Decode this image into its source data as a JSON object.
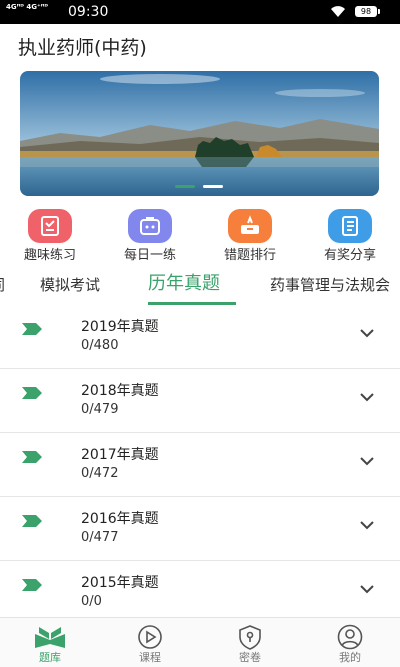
{
  "status_bar": {
    "network": "4Gᴴᴰ 4G⁺ᴴᴰ",
    "time": "09:30",
    "battery": "98"
  },
  "app_title": "执业药师(中药)",
  "banner": {
    "active_index": 0,
    "count": 2
  },
  "quick_actions": [
    {
      "label": "趣味练习",
      "icon": "form-icon",
      "color": "#f0626a"
    },
    {
      "label": "每日一练",
      "icon": "briefcase-icon",
      "color": "#8287ee"
    },
    {
      "label": "错题排行",
      "icon": "ranking-icon",
      "color": "#f57f3b"
    },
    {
      "label": "有奖分享",
      "icon": "notebook-icon",
      "color": "#3f9de8"
    }
  ],
  "tabs": [
    {
      "label": "同"
    },
    {
      "label": "模拟考试"
    },
    {
      "label": "历年真题",
      "active": true
    },
    {
      "label": "药事管理与法规会"
    }
  ],
  "exam_list": [
    {
      "title": "2019年真题",
      "progress": "0/480"
    },
    {
      "title": "2018年真题",
      "progress": "0/479"
    },
    {
      "title": "2017年真题",
      "progress": "0/472"
    },
    {
      "title": "2016年真题",
      "progress": "0/477"
    },
    {
      "title": "2015年真题",
      "progress": "0/0"
    }
  ],
  "bottom_nav": [
    {
      "label": "题库",
      "icon": "book-icon",
      "active": true
    },
    {
      "label": "课程",
      "icon": "play-icon"
    },
    {
      "label": "密卷",
      "icon": "shield-keyhole-icon"
    },
    {
      "label": "我的",
      "icon": "user-icon"
    }
  ],
  "colors": {
    "accent": "#3aa26a",
    "status_bar": "#000000"
  }
}
